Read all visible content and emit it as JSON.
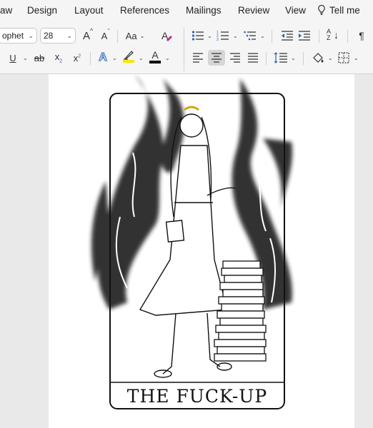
{
  "menu_tabs": [
    "aw",
    "Design",
    "Layout",
    "References",
    "Mailings",
    "Review",
    "View"
  ],
  "tell_me": {
    "label": "Tell me",
    "icon": "lightbulb-icon"
  },
  "font": {
    "name": "ophet",
    "size": "28"
  },
  "ribbon": {
    "row1_icons": [
      "grow-font-icon",
      "shrink-font-icon",
      "change-case-icon",
      "clear-formatting-icon",
      "bullets-icon",
      "numbering-icon",
      "multilevel-list-icon",
      "decrease-indent-icon",
      "increase-indent-icon",
      "sort-icon",
      "show-formatting-marks-icon"
    ],
    "row2_icons": [
      "underline-icon",
      "strikethrough-icon",
      "subscript-icon",
      "superscript-icon",
      "text-effects-icon",
      "highlight-icon",
      "font-color-icon",
      "align-left-icon",
      "align-center-icon",
      "align-right-icon",
      "justify-icon",
      "line-spacing-icon",
      "shading-icon",
      "borders-icon"
    ],
    "active_alignment": "center",
    "highlight_color": "#f7e600",
    "font_color": "#000000",
    "text_effects_color": "#1f5fbf",
    "glyphs": {
      "grow": "A",
      "shrink": "A",
      "change_case": "Aa",
      "underline": "U",
      "strike": "ab",
      "sub": "x",
      "sub_mark": "2",
      "sup": "x",
      "sup_mark": "2",
      "text_effects": "A",
      "font_color": "A",
      "pilcrow": "¶",
      "sort_a": "A",
      "sort_z": "Z"
    }
  },
  "document": {
    "card_title": "THE FUCK-UP",
    "illustration": "tarot card drawing of a girl in a dress with flower crown holding a book, standing before black flames beside a stack of books"
  }
}
